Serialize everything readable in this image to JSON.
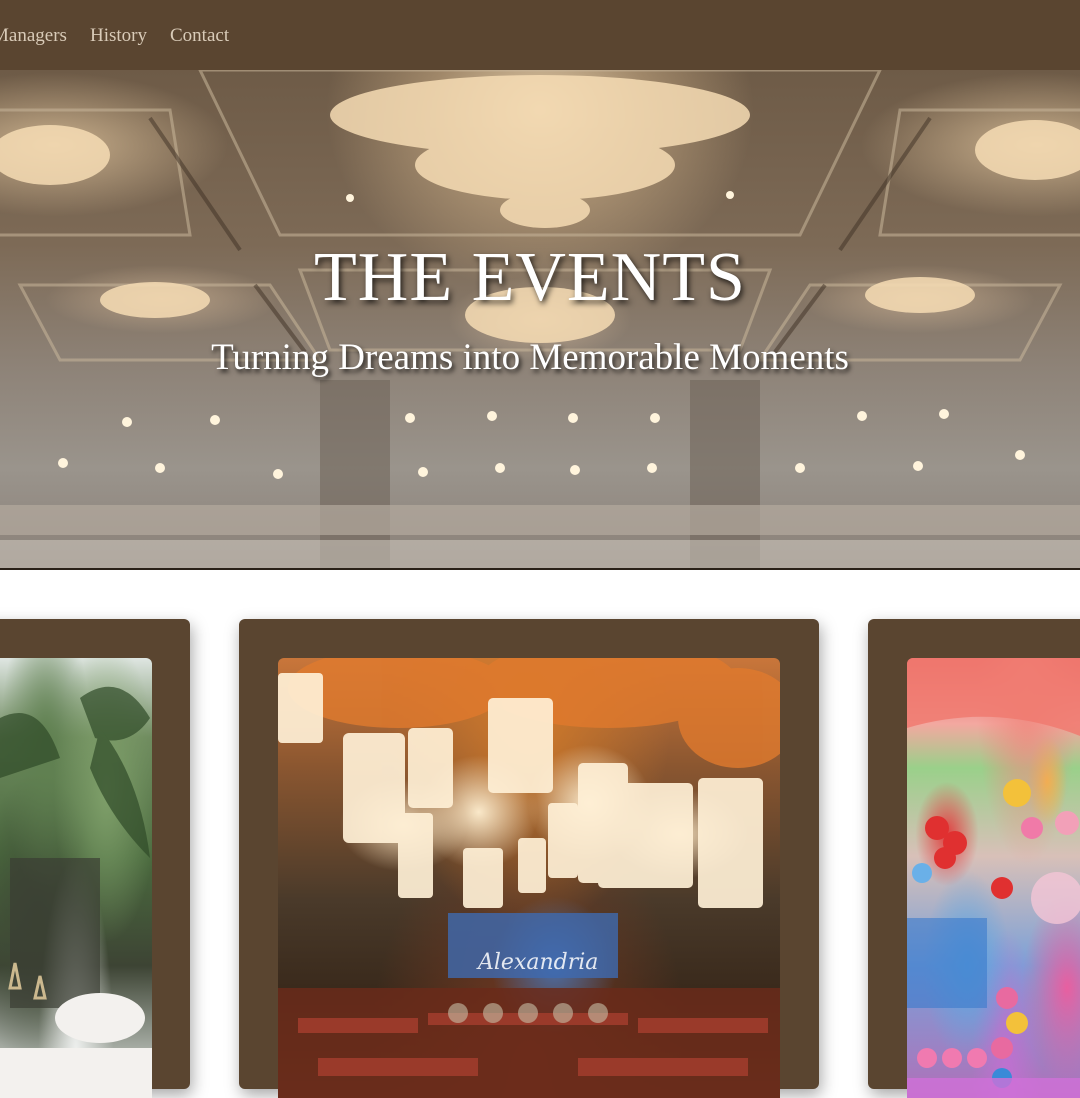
{
  "nav": {
    "links": [
      "Managers",
      "History",
      "Contact"
    ]
  },
  "hero": {
    "title": "THE EVENTS",
    "subtitle": "Turning Dreams into Memorable Moments"
  },
  "cards": [
    {
      "photo": "garden-event-photo"
    },
    {
      "photo": "lantern-banquet-photo",
      "signature": "Alexandria"
    },
    {
      "photo": "balloon-party-photo"
    }
  ],
  "colors": {
    "nav_background": "#5a4530",
    "card_frame": "#5a4530",
    "nav_text": "#d9cbb8",
    "hero_text": "#ffffff"
  }
}
